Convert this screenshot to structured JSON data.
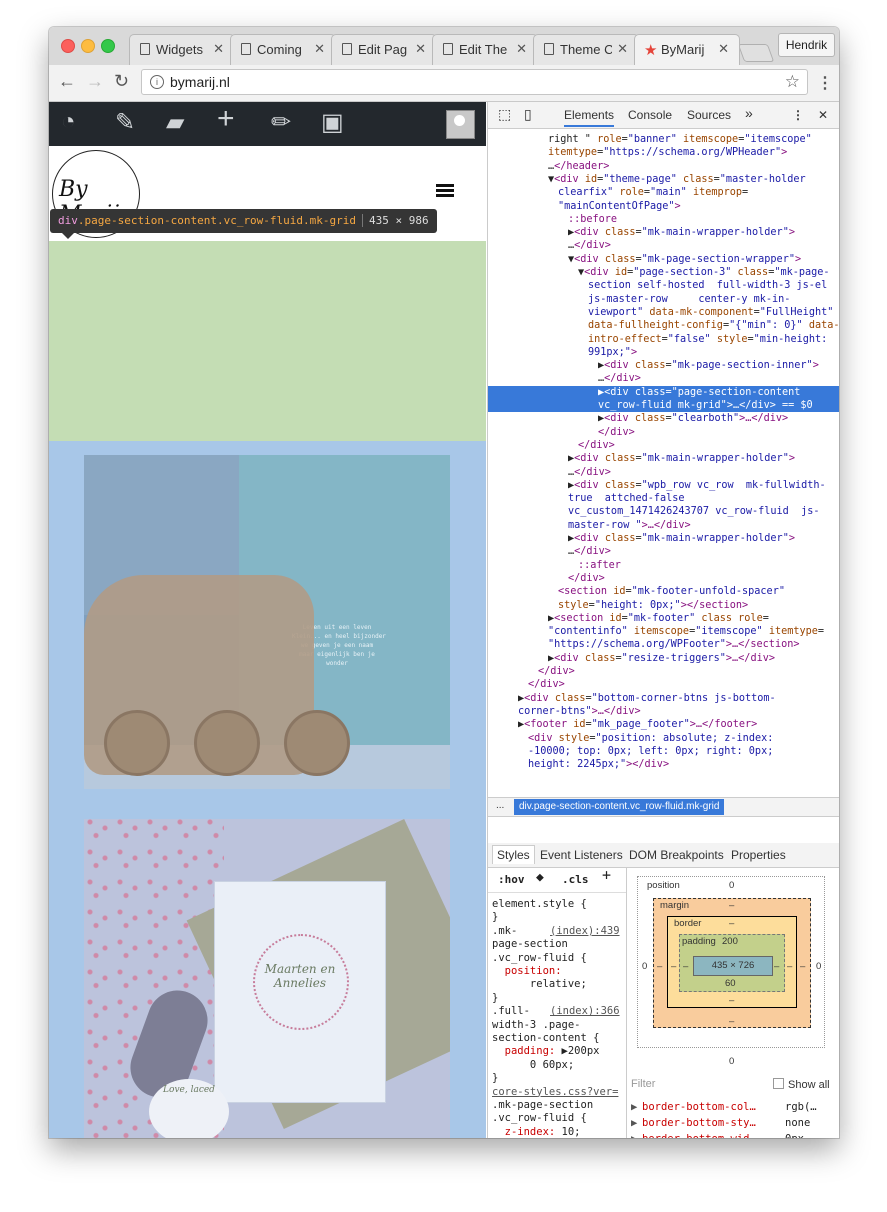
{
  "browser": {
    "tabs": [
      {
        "label": "Widgets"
      },
      {
        "label": "Coming"
      },
      {
        "label": "Edit Pag"
      },
      {
        "label": "Edit The"
      },
      {
        "label": "Theme C"
      },
      {
        "label": "ByMarij"
      }
    ],
    "profile": "Hendrik",
    "url": "bymarij.nl"
  },
  "page": {
    "logo_text": "By Marij",
    "tooltip": {
      "selector_tag": "div",
      "selector_class": ".page-section-content.vc_row-fluid.mk-grid",
      "dimensions": "435 × 986"
    },
    "card_text": "Leven uit een leven\nKlein... en heel bijzonder\nwe geven je een naam\nmaar eigenlijk ben je\nwonder",
    "invitation_title": "Maarten en Annelies",
    "tag_text": "Love, laced"
  },
  "devtools": {
    "tabs": [
      "Elements",
      "Console",
      "Sources",
      "»"
    ],
    "code_lines": [
      {
        "indent": 6,
        "parts": [
          [
            "gr",
            "right \" "
          ],
          [
            "an",
            "role"
          ],
          [
            "gr",
            "="
          ],
          [
            "av",
            "\"banner\""
          ],
          [
            "an",
            " itemscope"
          ],
          [
            "gr",
            "="
          ],
          [
            "av",
            "\"itemscope\""
          ]
        ]
      },
      {
        "indent": 6,
        "parts": [
          [
            "an",
            "itemtype"
          ],
          [
            "gr",
            "="
          ],
          [
            "av",
            "\"https://schema.org/WPHeader\""
          ],
          [
            "tg",
            ">"
          ]
        ]
      },
      {
        "indent": 6,
        "parts": [
          [
            "gr",
            "…"
          ],
          [
            "tg",
            "</header>"
          ]
        ]
      },
      {
        "indent": 6,
        "parts": [
          [
            "gr",
            "▼"
          ],
          [
            "tg",
            "<div "
          ],
          [
            "an",
            "id"
          ],
          [
            "gr",
            "="
          ],
          [
            "av",
            "\"theme-page\""
          ],
          [
            "an",
            " class"
          ],
          [
            "gr",
            "="
          ],
          [
            "av",
            "\"master-holder"
          ]
        ]
      },
      {
        "indent": 7,
        "parts": [
          [
            "av",
            "clearfix\""
          ],
          [
            "an",
            " role"
          ],
          [
            "gr",
            "="
          ],
          [
            "av",
            "\"main\""
          ],
          [
            "an",
            " itemprop"
          ],
          [
            "gr",
            "="
          ]
        ]
      },
      {
        "indent": 7,
        "parts": [
          [
            "av",
            "\"mainContentOfPage\""
          ],
          [
            "tg",
            ">"
          ]
        ]
      },
      {
        "indent": 8,
        "parts": [
          [
            "tg",
            "::before"
          ]
        ]
      },
      {
        "indent": 8,
        "parts": [
          [
            "gr",
            "▶"
          ],
          [
            "tg",
            "<div "
          ],
          [
            "an",
            "class"
          ],
          [
            "gr",
            "="
          ],
          [
            "av",
            "\"mk-main-wrapper-holder\""
          ],
          [
            "tg",
            ">"
          ]
        ]
      },
      {
        "indent": 8,
        "parts": [
          [
            "gr",
            "…"
          ],
          [
            "tg",
            "</div>"
          ]
        ]
      },
      {
        "indent": 8,
        "parts": [
          [
            "gr",
            "▼"
          ],
          [
            "tg",
            "<div "
          ],
          [
            "an",
            "class"
          ],
          [
            "gr",
            "="
          ],
          [
            "av",
            "\"mk-page-section-wrapper\""
          ],
          [
            "tg",
            ">"
          ]
        ]
      },
      {
        "indent": 9,
        "parts": [
          [
            "gr",
            "▼"
          ],
          [
            "tg",
            "<div "
          ],
          [
            "an",
            "id"
          ],
          [
            "gr",
            "="
          ],
          [
            "av",
            "\"page-section-3\""
          ],
          [
            "an",
            " class"
          ],
          [
            "gr",
            "="
          ],
          [
            "av",
            "\"mk-page-"
          ]
        ]
      },
      {
        "indent": 10,
        "parts": [
          [
            "av",
            "section self-hosted  full-width-3 js-el"
          ]
        ]
      },
      {
        "indent": 10,
        "parts": [
          [
            "av",
            "js-master-row     center-y mk-in-"
          ]
        ]
      },
      {
        "indent": 10,
        "parts": [
          [
            "av",
            "viewport\""
          ],
          [
            "an",
            " data-mk-component"
          ],
          [
            "gr",
            "="
          ],
          [
            "av",
            "\"FullHeight\""
          ]
        ]
      },
      {
        "indent": 10,
        "parts": [
          [
            "an",
            "data-fullheight-config"
          ],
          [
            "gr",
            "="
          ],
          [
            "av",
            "\"{\"min\": 0}\""
          ],
          [
            "an",
            " data-"
          ]
        ]
      },
      {
        "indent": 10,
        "parts": [
          [
            "an",
            "intro-effect"
          ],
          [
            "gr",
            "="
          ],
          [
            "av",
            "\"false\""
          ],
          [
            "an",
            " style"
          ],
          [
            "gr",
            "="
          ],
          [
            "av",
            "\"min-height:"
          ]
        ]
      },
      {
        "indent": 10,
        "parts": [
          [
            "av",
            "991px;\""
          ],
          [
            "tg",
            ">"
          ]
        ]
      },
      {
        "indent": 11,
        "parts": [
          [
            "gr",
            "▶"
          ],
          [
            "tg",
            "<div "
          ],
          [
            "an",
            "class"
          ],
          [
            "gr",
            "="
          ],
          [
            "av",
            "\"mk-page-section-inner\""
          ],
          [
            "tg",
            ">"
          ]
        ]
      },
      {
        "indent": 11,
        "parts": [
          [
            "gr",
            "…"
          ],
          [
            "tg",
            "</div>"
          ]
        ]
      },
      {
        "indent": 11,
        "hl": true,
        "parts": [
          [
            "gr",
            "▶"
          ],
          [
            "tg",
            "<div "
          ],
          [
            "an",
            "class"
          ],
          [
            "gr",
            "="
          ],
          [
            "av",
            "\"page-section-content"
          ]
        ]
      },
      {
        "indent": 11,
        "hl": true,
        "parts": [
          [
            "av",
            "vc_row-fluid mk-grid\""
          ],
          [
            "tg",
            ">…</div>"
          ],
          [
            "gr",
            " == $0"
          ]
        ]
      },
      {
        "indent": 11,
        "parts": [
          [
            "gr",
            "▶"
          ],
          [
            "tg",
            "<div "
          ],
          [
            "an",
            "class"
          ],
          [
            "gr",
            "="
          ],
          [
            "av",
            "\"clearboth\""
          ],
          [
            "tg",
            ">…</div>"
          ]
        ]
      },
      {
        "indent": 11,
        "parts": [
          [
            "tg",
            "</div>"
          ]
        ]
      },
      {
        "indent": 9,
        "parts": [
          [
            "tg",
            "</div>"
          ]
        ]
      },
      {
        "indent": 8,
        "parts": [
          [
            "gr",
            "▶"
          ],
          [
            "tg",
            "<div "
          ],
          [
            "an",
            "class"
          ],
          [
            "gr",
            "="
          ],
          [
            "av",
            "\"mk-main-wrapper-holder\""
          ],
          [
            "tg",
            ">"
          ]
        ]
      },
      {
        "indent": 8,
        "parts": [
          [
            "gr",
            "…"
          ],
          [
            "tg",
            "</div>"
          ]
        ]
      },
      {
        "indent": 8,
        "parts": [
          [
            "gr",
            "▶"
          ],
          [
            "tg",
            "<div "
          ],
          [
            "an",
            "class"
          ],
          [
            "gr",
            "="
          ],
          [
            "av",
            "\"wpb_row vc_row  mk-fullwidth-"
          ]
        ]
      },
      {
        "indent": 8,
        "parts": [
          [
            "av",
            "true  attched-false"
          ]
        ]
      },
      {
        "indent": 8,
        "parts": [
          [
            "av",
            "vc_custom_1471426243707 vc_row-fluid  js-"
          ]
        ]
      },
      {
        "indent": 8,
        "parts": [
          [
            "av",
            "master-row \""
          ],
          [
            "tg",
            ">…</div>"
          ]
        ]
      },
      {
        "indent": 8,
        "parts": [
          [
            "gr",
            "▶"
          ],
          [
            "tg",
            "<div "
          ],
          [
            "an",
            "class"
          ],
          [
            "gr",
            "="
          ],
          [
            "av",
            "\"mk-main-wrapper-holder\""
          ],
          [
            "tg",
            ">"
          ]
        ]
      },
      {
        "indent": 8,
        "parts": [
          [
            "gr",
            "…"
          ],
          [
            "tg",
            "</div>"
          ]
        ]
      },
      {
        "indent": 9,
        "parts": [
          [
            "tg",
            "::after"
          ]
        ]
      },
      {
        "indent": 8,
        "parts": [
          [
            "tg",
            "</div>"
          ]
        ]
      },
      {
        "indent": 7,
        "parts": [
          [
            "tg",
            "<section "
          ],
          [
            "an",
            "id"
          ],
          [
            "gr",
            "="
          ],
          [
            "av",
            "\"mk-footer-unfold-spacer\""
          ]
        ]
      },
      {
        "indent": 7,
        "parts": [
          [
            "an",
            "style"
          ],
          [
            "gr",
            "="
          ],
          [
            "av",
            "\"height: 0px;\""
          ],
          [
            "tg",
            "></section>"
          ]
        ]
      },
      {
        "indent": 6,
        "parts": [
          [
            "gr",
            "▶"
          ],
          [
            "tg",
            "<section "
          ],
          [
            "an",
            "id"
          ],
          [
            "gr",
            "="
          ],
          [
            "av",
            "\"mk-footer\""
          ],
          [
            "an",
            " class role"
          ],
          [
            "gr",
            "="
          ]
        ]
      },
      {
        "indent": 6,
        "parts": [
          [
            "av",
            "\"contentinfo\""
          ],
          [
            "an",
            " itemscope"
          ],
          [
            "gr",
            "="
          ],
          [
            "av",
            "\"itemscope\""
          ],
          [
            "an",
            " itemtype"
          ],
          [
            "gr",
            "="
          ]
        ]
      },
      {
        "indent": 6,
        "parts": [
          [
            "av",
            "\"https://schema.org/WPFooter\""
          ],
          [
            "tg",
            ">…</section>"
          ]
        ]
      },
      {
        "indent": 6,
        "parts": [
          [
            "gr",
            "▶"
          ],
          [
            "tg",
            "<div "
          ],
          [
            "an",
            "class"
          ],
          [
            "gr",
            "="
          ],
          [
            "av",
            "\"resize-triggers\""
          ],
          [
            "tg",
            ">…</div>"
          ]
        ]
      },
      {
        "indent": 5,
        "parts": [
          [
            "tg",
            "</div>"
          ]
        ]
      },
      {
        "indent": 4,
        "parts": [
          [
            "tg",
            "</div>"
          ]
        ]
      },
      {
        "indent": 3,
        "parts": [
          [
            "gr",
            "▶"
          ],
          [
            "tg",
            "<div "
          ],
          [
            "an",
            "class"
          ],
          [
            "gr",
            "="
          ],
          [
            "av",
            "\"bottom-corner-btns js-bottom-"
          ]
        ]
      },
      {
        "indent": 3,
        "parts": [
          [
            "av",
            "corner-btns\""
          ],
          [
            "tg",
            ">…</div>"
          ]
        ]
      },
      {
        "indent": 3,
        "parts": [
          [
            "gr",
            "▶"
          ],
          [
            "tg",
            "<footer "
          ],
          [
            "an",
            "id"
          ],
          [
            "gr",
            "="
          ],
          [
            "av",
            "\"mk_page_footer\""
          ],
          [
            "tg",
            ">…</footer>"
          ]
        ]
      },
      {
        "indent": 4,
        "parts": [
          [
            "tg",
            "<div "
          ],
          [
            "an",
            "style"
          ],
          [
            "gr",
            "="
          ],
          [
            "av",
            "\"position: absolute; z-index:"
          ]
        ]
      },
      {
        "indent": 4,
        "parts": [
          [
            "av",
            "-10000; top: 0px; left: 0px; right: 0px;"
          ]
        ]
      },
      {
        "indent": 4,
        "parts": [
          [
            "av",
            "height: 2245px;\""
          ],
          [
            "tg",
            "></div>"
          ]
        ]
      }
    ],
    "breadcrumb": {
      "more": "...",
      "current": "div.page-section-content.vc_row-fluid.mk-grid"
    },
    "side_tabs": [
      "Styles",
      "Event Listeners",
      "DOM Breakpoints",
      "Properties"
    ],
    "styles_toolbar": {
      "hov": ":hov",
      "cls": ".cls",
      "add": "+"
    },
    "styles_lines": [
      {
        "text": "element.style {",
        "kind": "plain"
      },
      {
        "text": "}",
        "kind": "plain"
      },
      {
        "text": ".mk-",
        "link": "(index):439",
        "kind": "sel"
      },
      {
        "text": "page-section",
        "kind": "plain"
      },
      {
        "text": ".vc_row-fluid {",
        "kind": "plain"
      },
      {
        "text": "  position:",
        "value": "",
        "kind": "prop"
      },
      {
        "text": "      relative;",
        "kind": "plain"
      },
      {
        "text": "}",
        "kind": "plain"
      },
      {
        "text": ".full-",
        "link": "(index):366",
        "kind": "sel"
      },
      {
        "text": "width-3 .page-",
        "kind": "plain"
      },
      {
        "text": "section-content {",
        "kind": "plain"
      },
      {
        "text": "  padding:",
        "value": "▶200px",
        "kind": "prop"
      },
      {
        "text": "      0 60px;",
        "kind": "plain"
      },
      {
        "text": "}",
        "kind": "plain"
      },
      {
        "text": "core-styles.css?ver=",
        "kind": "link"
      },
      {
        "text": ".mk-page-section",
        "kind": "plain"
      },
      {
        "text": ".vc_row-fluid {",
        "kind": "plain"
      },
      {
        "text": "  z-index:",
        "value": "10;",
        "kind": "prop"
      }
    ],
    "box_model": {
      "position_label": "position",
      "position_top": "0",
      "position_bottom": "0",
      "position_left": "0",
      "position_right": "0",
      "margin_label": "margin",
      "margin_top": "–",
      "margin_bottom": "–",
      "margin_left": "–",
      "margin_right": "–",
      "border_label": "border",
      "border_top": "–",
      "border_bottom": "–",
      "border_left": "–",
      "border_right": "–",
      "padding_label": "padding",
      "padding_top": "200",
      "padding_bottom": "60",
      "padding_left": "–",
      "padding_right": "–",
      "content": "435 × 726"
    },
    "computed": {
      "filter_placeholder": "Filter",
      "show_all": "Show all",
      "rows": [
        {
          "prop": "border-bottom-col…",
          "value": "rgb(…"
        },
        {
          "prop": "border-bottom-sty…",
          "value": "none"
        },
        {
          "prop": "border-bottom-wid…",
          "value": "0px"
        },
        {
          "prop": "border-image-outs…",
          "value": "0px"
        },
        {
          "prop": "border-image-repe…",
          "value": "stretch"
        }
      ]
    }
  }
}
